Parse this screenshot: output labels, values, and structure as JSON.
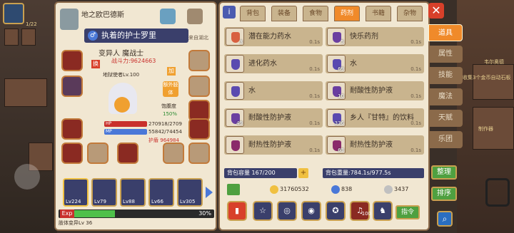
{
  "hud": {
    "left_level": "1/22",
    "right_caption_1": "韦尔奥德",
    "right_caption_2": "收集3个金币自动石板",
    "right_caption_3": "制作器"
  },
  "character": {
    "name": "地之欧巴德斯",
    "title": "执着的护士罗里",
    "gender_icon": "male",
    "origin": "来自湖北",
    "job": "变异人 魔战士",
    "power_label": "战斗力",
    "power_value": "9624663",
    "status_line": "地狱使者Lv.100",
    "equip_tag_1": "换",
    "equip_tag_2": "加",
    "extra_body_label": "额外肢体",
    "satiety_label": "饱腹度",
    "satiety_value": "150%",
    "hp_label": "HP",
    "hp_value": "270918/2709",
    "mp_label": "MP",
    "mp_value": "55842/74454",
    "shield_label": "护盾",
    "shield_value": "964984",
    "party_levels": [
      "Lv224",
      "Lv79",
      "Lv88",
      "Lv66",
      "Lv305"
    ],
    "exp_label": "Exp",
    "exp_pct": "30%",
    "exp_fraction": 0.3,
    "bond_label": "肢体变异Lv 36"
  },
  "inventory": {
    "tabs": [
      "背包",
      "装备",
      "食物",
      "药剂",
      "书籍",
      "杂物"
    ],
    "active_tab": "药剂",
    "items": [
      {
        "name": "潜在能力药水",
        "count": "3",
        "weight": "0.1s",
        "color": "#d86040"
      },
      {
        "name": "快乐药剂",
        "count": "5",
        "weight": "0.1s",
        "color": "#6a3ea0"
      },
      {
        "name": "进化药水",
        "count": "",
        "weight": "0.1s",
        "color": "#5a4ab0"
      },
      {
        "name": "水",
        "count": "69",
        "weight": "0.1s",
        "color": "#5a4ab0"
      },
      {
        "name": "水",
        "count": "",
        "weight": "0.1s",
        "color": "#5a4ab0"
      },
      {
        "name": "耐酸性防护液",
        "count": "10",
        "weight": "0.1s",
        "color": "#6a3ea0"
      },
      {
        "name": "耐酸性防护液",
        "count": "49",
        "weight": "0.1s",
        "color": "#6a3ea0"
      },
      {
        "name": "乡人『甘特』的饮料",
        "count": "336",
        "weight": "0.1s",
        "color": "#5a4ab0"
      },
      {
        "name": "耐热性防护液",
        "count": "",
        "weight": "0.1s",
        "color": "#8a2a6a"
      },
      {
        "name": "耐热性防护液",
        "count": "63",
        "weight": "0.1s",
        "color": "#8a2a6a"
      }
    ],
    "capacity_label": "背包容量 167/200",
    "weight_label": "背包重量:784.1s/977.5s",
    "gold": "31760532",
    "gems": "838",
    "silver": "3437",
    "action_count": "100",
    "command_label": "指令"
  },
  "categories": [
    "道具",
    "属性",
    "技能",
    "魔法",
    "天赋",
    "乐团"
  ],
  "active_category": "道具",
  "side_buttons": [
    "整理",
    "排序"
  ],
  "colors": {
    "accent": "#f08a2a",
    "panel": "#f1e7d2",
    "frame": "#8b6a4a",
    "navy": "#3a3f6b"
  }
}
